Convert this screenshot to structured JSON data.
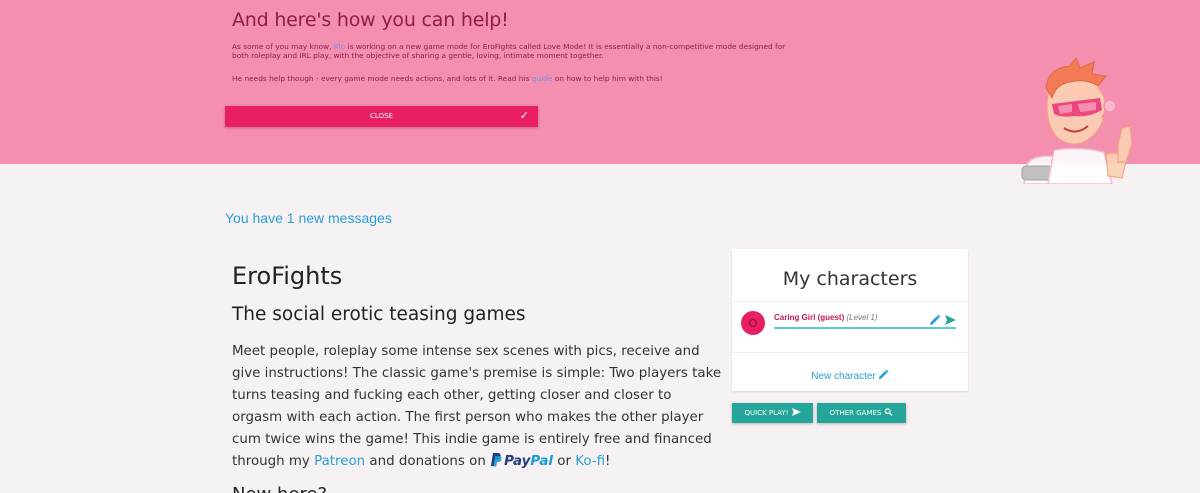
{
  "banner": {
    "title": "And here's how you can help!",
    "p1_before": "As some of you may know, ",
    "p1_link": "Klo",
    "p1_after": " is working on a new game mode for EroFights called Love Mode! It is essentially a non-competitive mode designed for both roleplay and IRL play, with the objective of sharing a gentle, loving, intimate moment together.",
    "p2_before": "He needs help though - every game mode needs actions, and lots of it. Read his ",
    "p2_link": "guide",
    "p2_after": " on how to help him with this!",
    "close_label": "CLOSE",
    "close_icon": "check-icon",
    "bg_color": "#f48fb0",
    "button_color": "#e91e63"
  },
  "messages_link": "You have 1 new messages",
  "main": {
    "title": "EroFights",
    "subtitle": "The social erotic teasing games",
    "desc_text": "Meet people, roleplay some intense sex scenes with pics, receive and give instructions! The classic game's premise is simple: Two players take turns teasing and fucking each other, getting closer and closer to orgasm with each action. The first person who makes the other player cum twice wins the game! This indie game is entirely free and financed through my ",
    "patreon_link": "Patreon",
    "donations_text": " and donations on ",
    "paypal_pay": "Pay",
    "paypal_pal": "Pal",
    "or_text": " or ",
    "kofi_link": "Ko-fi",
    "end_text": "!",
    "next_heading_cut": "New here?"
  },
  "characters": {
    "title": "My characters",
    "items": [
      {
        "name": "Caring Girl (guest)",
        "level": "(Level 1)"
      }
    ],
    "new_character": "New character"
  },
  "buttons": {
    "quick_play": "QUICK PLAY!",
    "other_games": "OTHER GAMES"
  },
  "colors": {
    "link": "#2a9fd6",
    "teal": "#26a69a",
    "page_bg": "#f6f1f2"
  }
}
